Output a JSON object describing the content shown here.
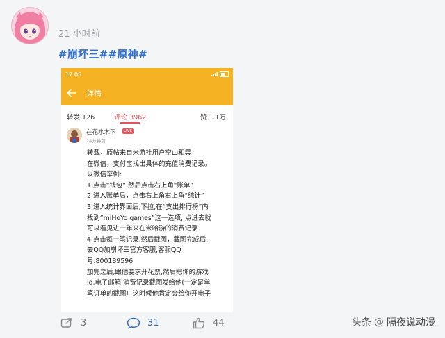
{
  "post": {
    "timestamp": "21 小时前",
    "tags": "#崩坏三##原神#"
  },
  "screenshot": {
    "status_time": "17:05",
    "title": "详情",
    "counts": {
      "reposts": "转发 126",
      "comments": "评论 3962",
      "likes": "赞 1.1万"
    },
    "comment": {
      "author": "在花水木下",
      "badge": "LIVE",
      "time": "24分钟前",
      "lines": [
        "转载，原帖来自米游社用户空山和雲",
        "在微信，支付宝找出具体的充值消费记录。",
        "以微信举例:",
        "1.点击“钱包”,然后点击右上角“账单”",
        "2.进入账单后，点击右上角右上角“统计”",
        "3.进入统计界面后,下拉,在“支出排行榜”内",
        "找到“miHoYo games”这一选项, 点进去就",
        "可以看见进一年来在米哈游的消费记录",
        "4.点击每一笔记录,然后截图，截图完成后,",
        "去QQ加崩坏三官方客服,客服QQ",
        "号:800189596",
        "加完之后,跟他要求开花票,然后把你的游戏",
        "id,电子邮箱,消费记录截图发给他(一定是单",
        "笔订单的截图）这时候他肯定会给你开电子"
      ]
    }
  },
  "actions": {
    "reposts": "3",
    "comments": "31",
    "likes": "44"
  },
  "watermark": {
    "prefix": "头条",
    "at": "@",
    "account": "隔夜说动漫"
  }
}
